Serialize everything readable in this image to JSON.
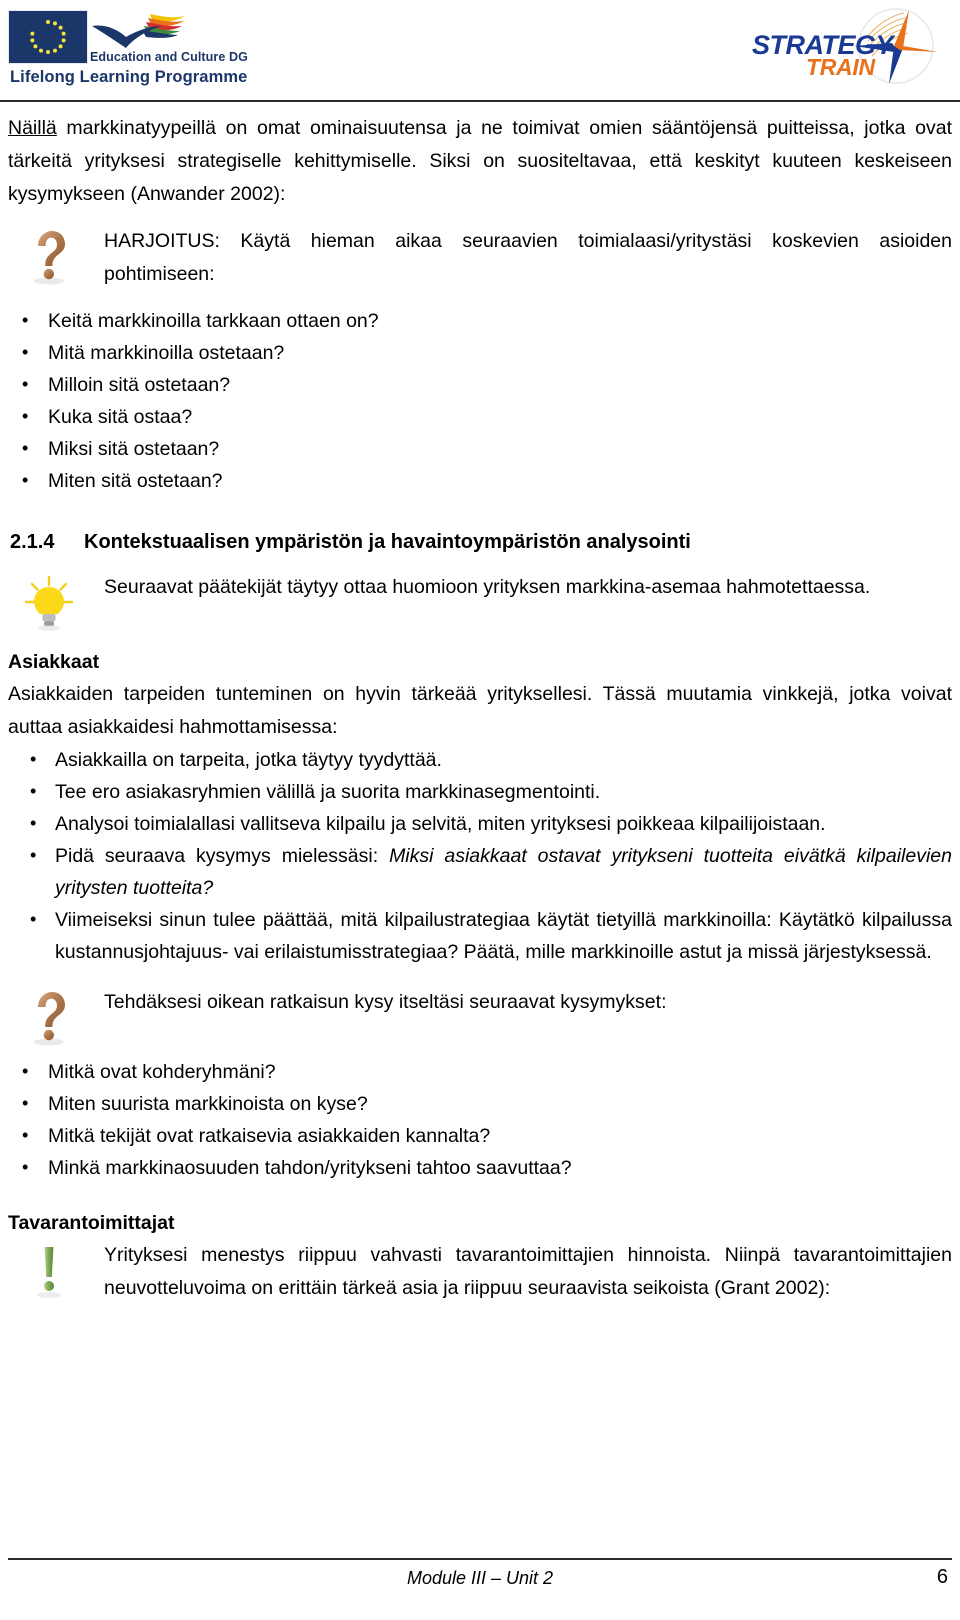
{
  "header": {
    "eu_logo": {
      "line1": "Education and Culture DG",
      "line2": "Lifelong Learning Programme",
      "flag_color": "#1b3668",
      "star_color": "#f5e23c",
      "text_color": "#1b3668"
    },
    "strategy_train_logo": {
      "word1": "STRATEGY",
      "word2": "TRAIN",
      "word1_color": "#1a3a93",
      "word2_color": "#e8711a"
    }
  },
  "body": {
    "intro_underlined": "Näillä",
    "intro_rest": " markkinatyypeillä on omat ominaisuutensa ja ne toimivat omien sääntöjensä puitteissa, jotka ovat tärkeitä yrityksesi strategiselle kehittymiselle. Siksi on suositeltavaa, että keskityt kuuteen keskeiseen kysymykseen (Anwander 2002):",
    "exercise_callout": {
      "icon": "question-mark-icon",
      "icon_color": "#a5683f",
      "text": "HARJOITUS: Käytä hieman aikaa seuraavien toimialaasi/yritystäsi koskevien asioiden pohtimiseen:"
    },
    "exercise_questions": [
      "Keitä markkinoilla tarkkaan ottaen on?",
      "Mitä markkinoilla ostetaan?",
      "Milloin sitä ostetaan?",
      "Kuka sitä ostaa?",
      "Miksi sitä ostetaan?",
      "Miten sitä ostetaan?"
    ],
    "section": {
      "number": "2.1.4",
      "title": "Kontekstuaalisen ympäristön ja havaintoympäristön analysointi"
    },
    "tip_callout": {
      "icon": "lightbulb-icon",
      "icon_color": "#f5d020",
      "text": "Seuraavat päätekijät täytyy ottaa huomioon yrityksen markkina-asemaa hahmotettaessa."
    },
    "customers": {
      "heading": "Asiakkaat",
      "paragraph": "Asiakkaiden tarpeiden tunteminen on hyvin tärkeää yrityksellesi. Tässä muutamia vinkkejä, jotka voivat auttaa asiakkaidesi hahmottamisessa:",
      "bullets": [
        {
          "text": "Asiakkailla on tarpeita, jotka täytyy tyydyttää.",
          "italic_part": ""
        },
        {
          "text": "Tee ero asiakasryhmien välillä ja suorita markkinasegmentointi.",
          "italic_part": ""
        },
        {
          "text": "Analysoi toimialallasi vallitseva kilpailu ja selvitä, miten yrityksesi poikkeaa kilpailijoistaan.",
          "italic_part": ""
        },
        {
          "text": "Pidä seuraava kysymys mielessäsi: ",
          "italic_part": "Miksi asiakkaat ostavat yritykseni tuotteita eivätkä kilpailevien yritysten tuotteita?"
        },
        {
          "text": "Viimeiseksi sinun tulee päättää, mitä kilpailustrategiaa käytät tietyillä markkinoilla: Käytätkö kilpailussa kustannusjohtajuus- vai erilaistumisstrategiaa? Päätä, mille markkinoille astut ja missä järjestyksessä.",
          "italic_part": ""
        }
      ]
    },
    "decision_callout": {
      "icon": "question-mark-icon",
      "icon_color": "#a5683f",
      "text": "Tehdäksesi oikean ratkaisun kysy itseltäsi seuraavat kysymykset:"
    },
    "decision_questions": [
      "Mitkä ovat kohderyhmäni?",
      "Miten suurista markkinoista on kyse?",
      "Mitkä tekijät ovat ratkaisevia asiakkaiden kannalta?",
      "Minkä markkinaosuuden tahdon/yritykseni tahtoo saavuttaa?"
    ],
    "suppliers": {
      "heading": "Tavarantoimittajat",
      "icon": "exclamation-mark-icon",
      "icon_color": "#7aa04f",
      "text": "Yrityksesi menestys riippuu vahvasti tavarantoimittajien hinnoista. Niinpä tavarantoimittajien neuvotteluvoima on erittäin tärkeä asia ja riippuu seuraavista seikoista (Grant 2002):"
    }
  },
  "footer": {
    "center": "Module III – Unit 2",
    "page_number": "6"
  }
}
